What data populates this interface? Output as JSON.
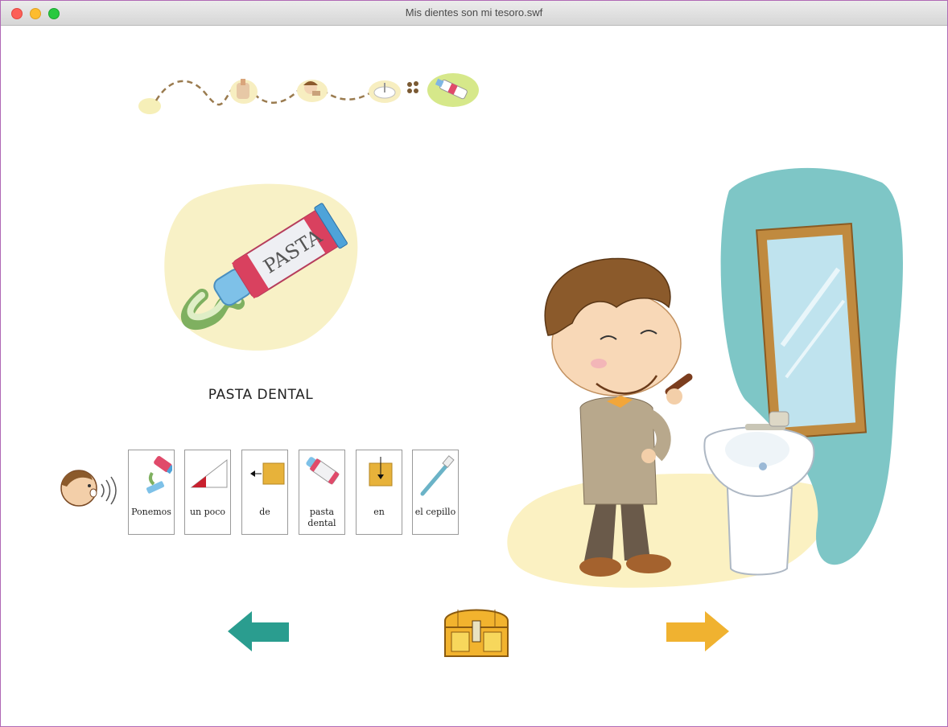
{
  "window": {
    "title": "Mis dientes son mi tesoro.swf"
  },
  "progress_path": {
    "step_icons": [
      "paste-step-icon",
      "face-step-icon",
      "sink-step-icon",
      "toothpaste-step-icon"
    ]
  },
  "main": {
    "word_label": "PASTA DENTAL",
    "pictogram_sentence": [
      {
        "text": "Ponemos",
        "icon": "toothpaste-squeeze-icon"
      },
      {
        "text": "un poco",
        "icon": "small-wedge-icon"
      },
      {
        "text": "de",
        "icon": "of-arrow-icon"
      },
      {
        "text": "pasta dental",
        "icon": "toothpaste-tube-icon"
      },
      {
        "text": "en",
        "icon": "into-arrow-icon"
      },
      {
        "text": "el cepillo",
        "icon": "toothbrush-icon"
      }
    ]
  },
  "navigation": {
    "back_icon": "arrow-left-icon",
    "home_icon": "treasure-chest-icon",
    "next_icon": "arrow-right-icon"
  },
  "colors": {
    "back_arrow": "#2a9d8f",
    "next_arrow": "#f0b230",
    "chest": "#f2b32e",
    "wall": "#7ec6c6",
    "floor_blob": "#fbf1c2"
  }
}
